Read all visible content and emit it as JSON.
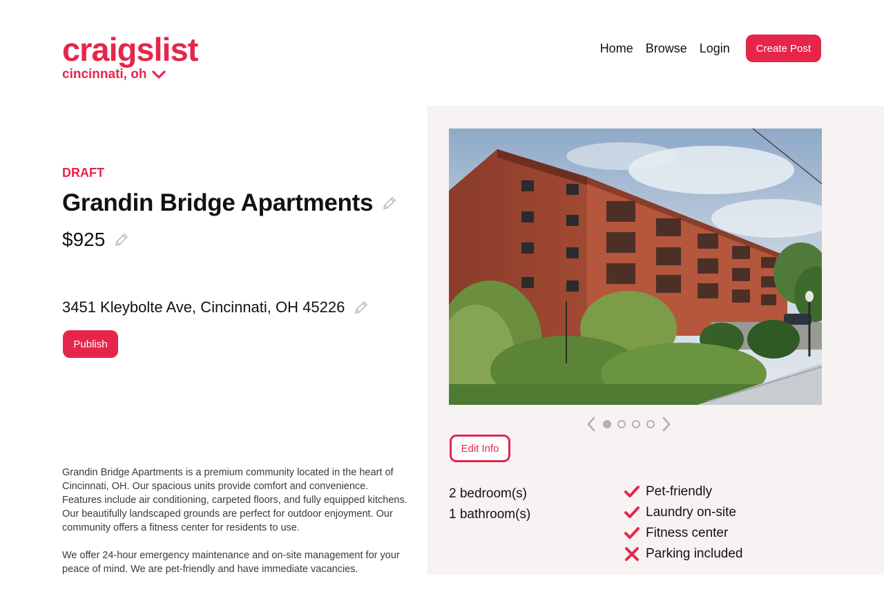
{
  "brand": {
    "logo": "craigslist",
    "location": "cincinnati, oh",
    "accent": "#e5264a"
  },
  "nav": {
    "home": "Home",
    "browse": "Browse",
    "login": "Login",
    "create_post": "Create Post"
  },
  "listing": {
    "status": "DRAFT",
    "title": "Grandin Bridge Apartments",
    "price": "$925",
    "address": "3451 Kleybolte Ave, Cincinnati, OH 45226",
    "publish_label": "Publish",
    "description": [
      "Grandin Bridge Apartments is a premium community located in the heart of Cincinnati, OH. Our spacious units provide comfort and convenience. Features include air conditioning, carpeted floors, and fully equipped kitchens. Our beautifully landscaped grounds are perfect for outdoor enjoyment. Our community offers a fitness center for residents to use.",
      "We offer 24-hour emergency maintenance and on-site management for your peace of mind. We are pet-friendly and have immediate vacancies."
    ]
  },
  "gallery": {
    "image_count": 4,
    "active_index": 0,
    "edit_label": "Edit Info"
  },
  "details": {
    "bedrooms": "2 bedroom(s)",
    "bathrooms": "1 bathroom(s)"
  },
  "amenities": [
    {
      "label": "Pet-friendly",
      "included": true,
      "icon": "check-icon"
    },
    {
      "label": "Laundry on-site",
      "included": true,
      "icon": "check-icon"
    },
    {
      "label": "Fitness center",
      "included": true,
      "icon": "check-icon"
    },
    {
      "label": "Parking included",
      "included": false,
      "icon": "x-icon"
    }
  ]
}
